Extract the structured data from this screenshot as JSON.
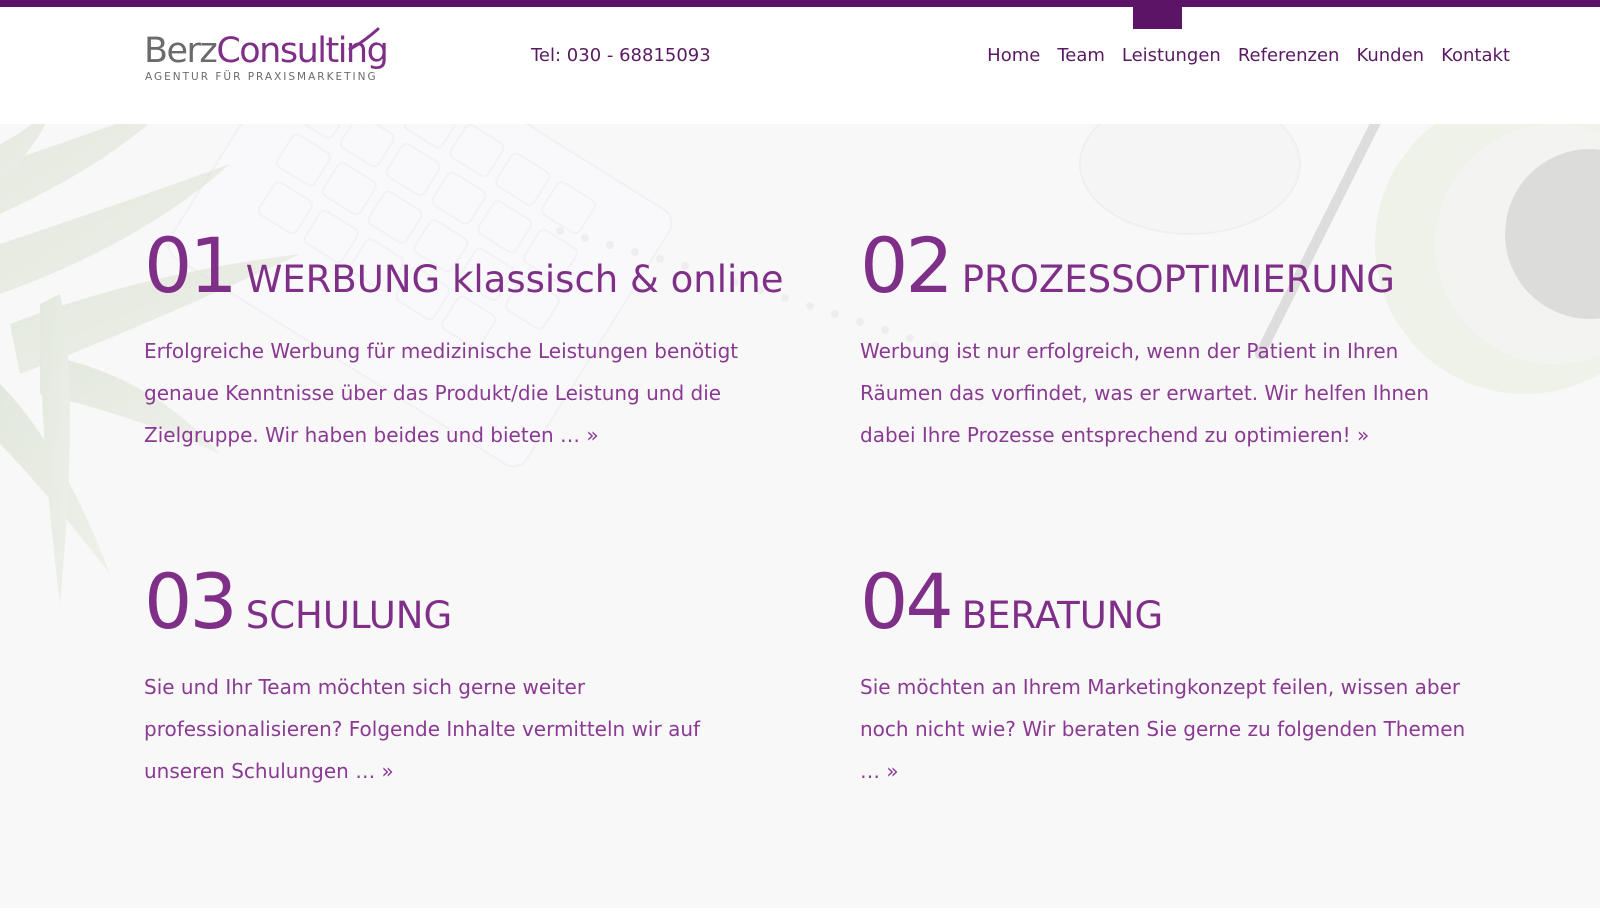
{
  "colors": {
    "brand_purple": "#5c1566",
    "accent_purple": "#7f2f88",
    "logo_gray": "#6b6b6b"
  },
  "header": {
    "logo": {
      "part1": "Berz",
      "part2": "Consulting",
      "tagline": "AGENTUR FÜR PRAXISMARKETING"
    },
    "phone": "Tel: 030 - 68815093",
    "nav": {
      "home": "Home",
      "team": "Team",
      "leistungen": "Leistungen",
      "referenzen": "Referenzen",
      "kunden": "Kunden",
      "kontakt": "Kontakt"
    }
  },
  "services": [
    {
      "number": "01",
      "title": "WERBUNG klassisch & online",
      "text": "Erfolgreiche Werbung für medizinische Leistungen benötigt genaue Kenntnisse über das Produkt/die Leistung und die Zielgruppe. Wir haben beides und bieten",
      "more": "… »"
    },
    {
      "number": "02",
      "title": "PROZESSOPTIMIERUNG",
      "text": "Werbung ist nur erfolgreich, wenn der Patient in Ihren Räumen das vorfindet, was er erwartet. Wir helfen Ihnen dabei Ihre Prozesse entsprechend zu optimieren!",
      "more": "»"
    },
    {
      "number": "03",
      "title": "SCHULUNG",
      "text": "Sie und Ihr Team möchten sich gerne weiter professionalisieren? Folgende Inhalte vermitteln wir auf unseren Schulungen",
      "more": "… »"
    },
    {
      "number": "04",
      "title": "BERATUNG",
      "text": "Sie möchten an Ihrem Marketingkonzept feilen, wissen aber noch nicht wie? Wir beraten Sie gerne zu folgenden Themen",
      "more": "… »"
    }
  ]
}
